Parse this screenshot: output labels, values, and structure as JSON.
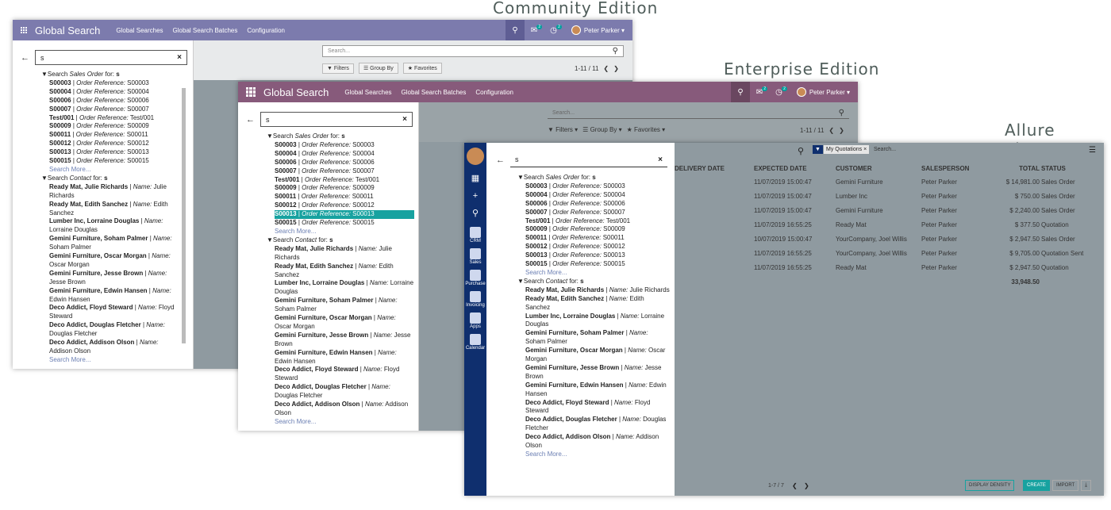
{
  "editions": {
    "community": "Community Edition",
    "enterprise": "Enterprise Edition",
    "allure": "Allure Theme"
  },
  "app": {
    "name": "Global Search",
    "menus": [
      "Global Searches",
      "Global Search Batches",
      "Configuration"
    ],
    "user": "Peter Parker",
    "badges": [
      "2",
      "2"
    ]
  },
  "search": {
    "value": "s",
    "placeholder": "Search...",
    "filters": "Filters",
    "group_by": "Group By",
    "favorites": "Favorites",
    "pager": "1-11 / 11"
  },
  "results": {
    "sales_header": {
      "prefix": "Search",
      "model": "Sales Order",
      "suffix": "for:",
      "term": "s"
    },
    "sales_rows": [
      {
        "name": "S00003",
        "field": "Order Reference:",
        "value": "S00003"
      },
      {
        "name": "S00004",
        "field": "Order Reference:",
        "value": "S00004"
      },
      {
        "name": "S00006",
        "field": "Order Reference:",
        "value": "S00006"
      },
      {
        "name": "S00007",
        "field": "Order Reference:",
        "value": "S00007"
      },
      {
        "name": "Test/001",
        "field": "Order Reference:",
        "value": "Test/001"
      },
      {
        "name": "S00009",
        "field": "Order Reference:",
        "value": "S00009"
      },
      {
        "name": "S00011",
        "field": "Order Reference:",
        "value": "S00011"
      },
      {
        "name": "S00012",
        "field": "Order Reference:",
        "value": "S00012"
      },
      {
        "name": "S00013",
        "field": "Order Reference:",
        "value": "S00013"
      },
      {
        "name": "S00015",
        "field": "Order Reference:",
        "value": "S00015"
      }
    ],
    "more": "Search More...",
    "contact_header": {
      "prefix": "Search",
      "model": "Contact",
      "suffix": "for:",
      "term": "s"
    },
    "contact_rows": [
      {
        "name": "Ready Mat, Julie Richards",
        "field": "Name:",
        "value": "Julie Richards"
      },
      {
        "name": "Ready Mat, Edith Sanchez",
        "field": "Name:",
        "value": "Edith Sanchez"
      },
      {
        "name": "Lumber Inc, Lorraine Douglas",
        "field": "Name:",
        "value": "Lorraine Douglas"
      },
      {
        "name": "Gemini Furniture, Soham Palmer",
        "field": "Name:",
        "value": "Soham Palmer"
      },
      {
        "name": "Gemini Furniture, Oscar Morgan",
        "field": "Name:",
        "value": "Oscar Morgan"
      },
      {
        "name": "Gemini Furniture, Jesse Brown",
        "field": "Name:",
        "value": "Jesse Brown"
      },
      {
        "name": "Gemini Furniture, Edwin Hansen",
        "field": "Name:",
        "value": "Edwin Hansen"
      },
      {
        "name": "Deco Addict, Floyd Steward",
        "field": "Name:",
        "value": "Floyd Steward"
      },
      {
        "name": "Deco Addict, Douglas Fletcher",
        "field": "Name:",
        "value": "Douglas Fletcher"
      },
      {
        "name": "Deco Addict, Addison Olson",
        "field": "Name:",
        "value": "Addison Olson"
      }
    ]
  },
  "allure": {
    "sidebar": [
      "CRM",
      "Sales",
      "Purchase",
      "Invoicing",
      "Apps",
      "Calendar"
    ],
    "facet": "My Quotations",
    "columns": [
      "DELIVERY DATE",
      "EXPECTED DATE",
      "CUSTOMER",
      "SALESPERSON",
      "TOTAL",
      "STATUS"
    ],
    "rows": [
      [
        "11/07/2019 15:00:47",
        "Gemini Furniture",
        "Peter Parker",
        "$ 14,981.00",
        "Sales Order"
      ],
      [
        "11/07/2019 15:00:47",
        "Lumber Inc",
        "Peter Parker",
        "$ 750.00",
        "Sales Order"
      ],
      [
        "11/07/2019 15:00:47",
        "Gemini Furniture",
        "Peter Parker",
        "$ 2,240.00",
        "Sales Order"
      ],
      [
        "11/07/2019 16:55:25",
        "Ready Mat",
        "Peter Parker",
        "$ 377.50",
        "Quotation"
      ],
      [
        "10/07/2019 15:00:47",
        "YourCompany, Joel Willis",
        "Peter Parker",
        "$ 2,947.50",
        "Sales Order"
      ],
      [
        "11/07/2019 16:55:25",
        "YourCompany, Joel Willis",
        "Peter Parker",
        "$ 9,705.00",
        "Quotation Sent"
      ],
      [
        "11/07/2019 16:55:25",
        "Ready Mat",
        "Peter Parker",
        "$ 2,947.50",
        "Quotation"
      ]
    ],
    "sum": "33,948.50",
    "pager": "1-7 / 7",
    "buttons": [
      "DISPLAY DENSITY",
      "CREATE",
      "IMPORT"
    ],
    "colors": {
      "sidebar": "#0f2f6e",
      "accent": "#17a2a0"
    }
  },
  "colors": {
    "community": "#7c7bad",
    "enterprise": "#875a7b"
  }
}
